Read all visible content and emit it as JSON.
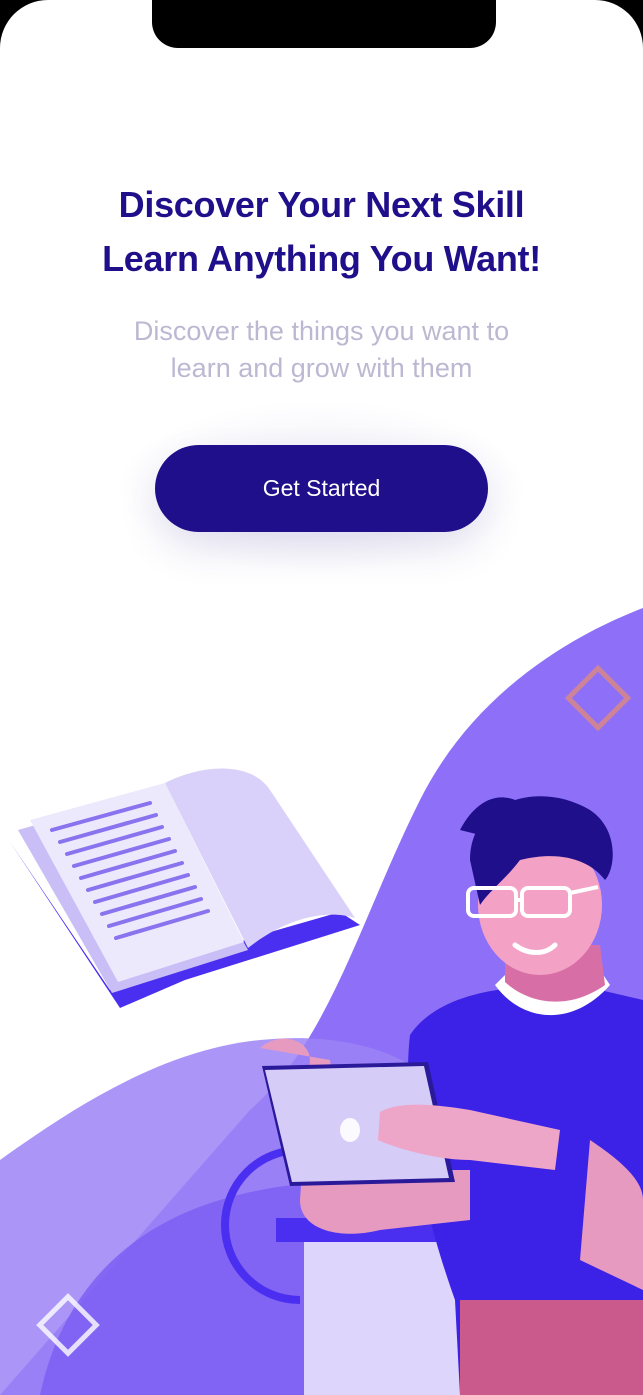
{
  "onboarding": {
    "headline_line1": "Discover Your Next Skill",
    "headline_line2": "Learn Anything You Want!",
    "subtitle_line1": "Discover the things you want to",
    "subtitle_line2": "learn and grow with them",
    "cta_label": "Get Started"
  },
  "illustration": {
    "subject": "person-with-tablet-and-book"
  },
  "colors": {
    "primary": "#1f0f8a",
    "accent_purple": "#7b61ff",
    "subtitle_gray": "#bdb8d2",
    "background": "#ffffff"
  }
}
